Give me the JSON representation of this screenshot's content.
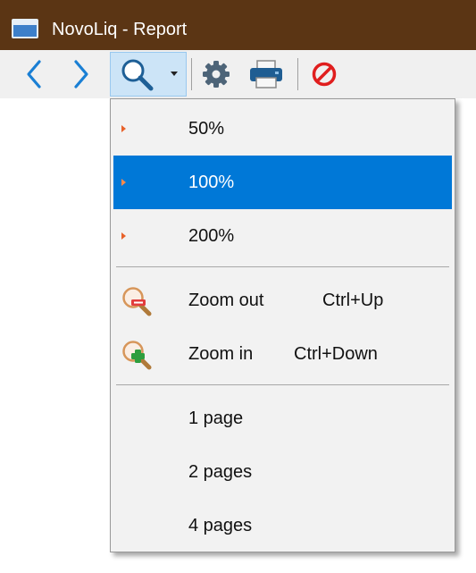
{
  "window": {
    "title": "NovoLiq - Report",
    "accent": "#5b3514"
  },
  "toolbar": {
    "buttons": [
      {
        "name": "back",
        "icon": "chevron-left-icon"
      },
      {
        "name": "forward",
        "icon": "chevron-right-icon"
      },
      {
        "name": "zoom",
        "icon": "magnifier-icon"
      },
      {
        "name": "zoom-dropdown",
        "icon": "caret-down-icon"
      },
      {
        "name": "settings",
        "icon": "gear-icon"
      },
      {
        "name": "print",
        "icon": "printer-icon"
      },
      {
        "name": "stop",
        "icon": "no-entry-icon"
      }
    ]
  },
  "zoom_menu": {
    "selected_color": "#0078d7",
    "presets": [
      {
        "label": "50%",
        "selected": false
      },
      {
        "label": "100%",
        "selected": true
      },
      {
        "label": "200%",
        "selected": false
      }
    ],
    "zoom_out": {
      "label": "Zoom out",
      "shortcut": "Ctrl+Up",
      "icon": "zoom-out-icon"
    },
    "zoom_in": {
      "label": "Zoom in",
      "shortcut": "Ctrl+Down",
      "icon": "zoom-in-icon"
    },
    "page_layouts": [
      {
        "label": "1 page"
      },
      {
        "label": "2 pages"
      },
      {
        "label": "4 pages"
      }
    ]
  }
}
